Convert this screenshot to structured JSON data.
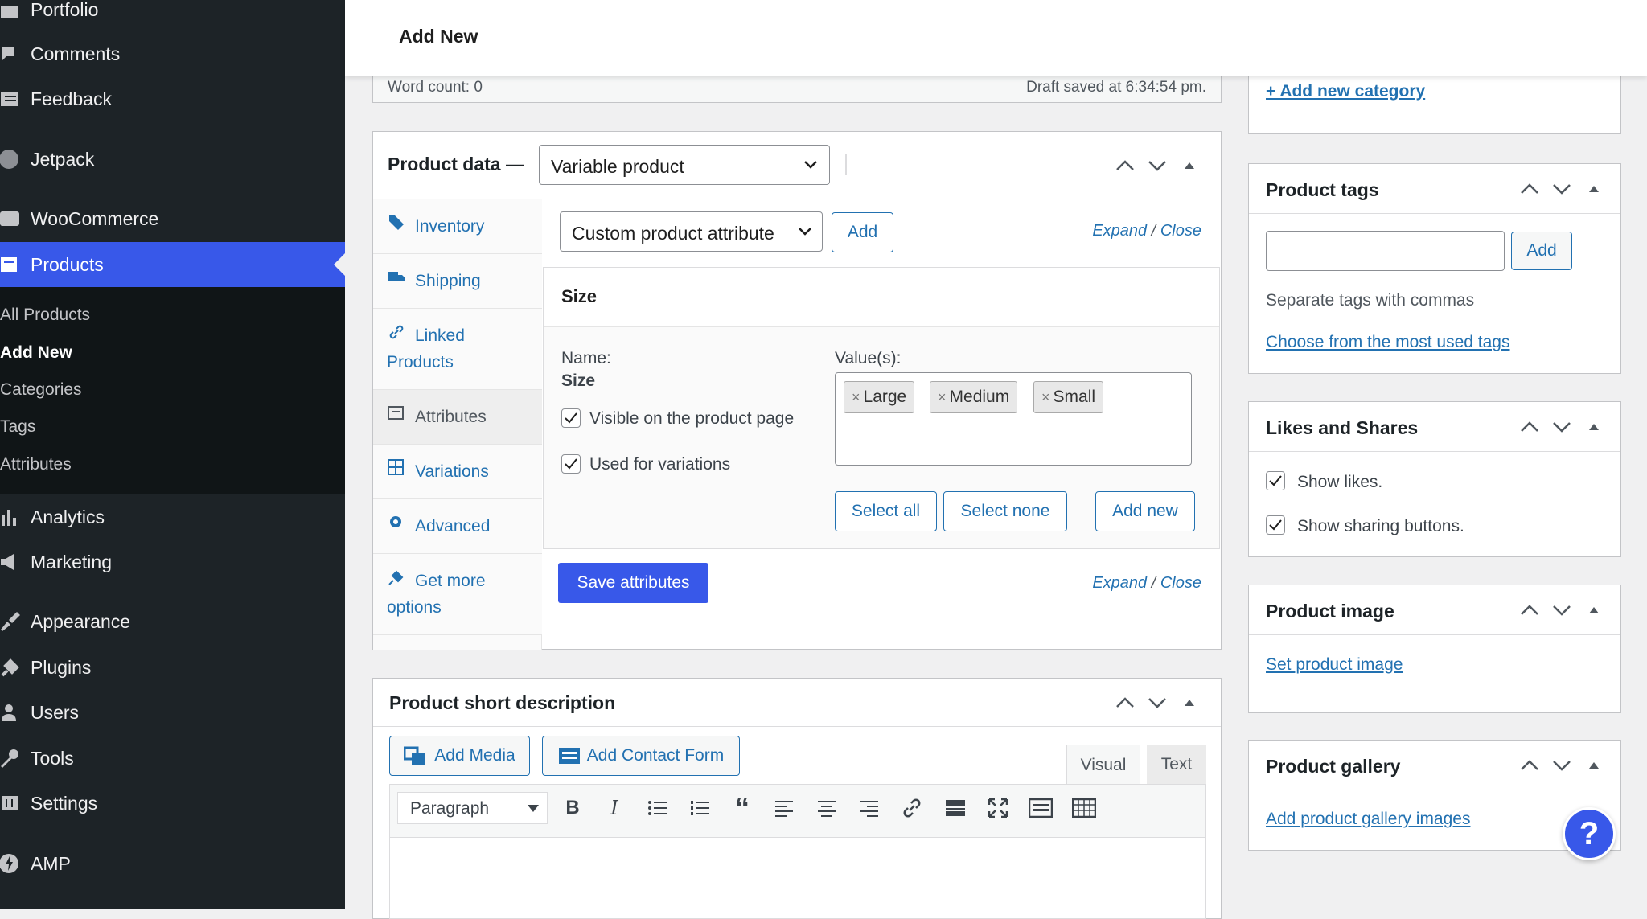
{
  "sidebar": {
    "items": {
      "portfolio": "Portfolio",
      "comments": "Comments",
      "feedback": "Feedback",
      "jetpack": "Jetpack",
      "woocommerce": "WooCommerce",
      "products": "Products",
      "analytics": "Analytics",
      "marketing": "Marketing",
      "appearance": "Appearance",
      "plugins": "Plugins",
      "users": "Users",
      "tools": "Tools",
      "settings": "Settings",
      "amp": "AMP"
    },
    "submenu": {
      "all": "All Products",
      "add": "Add New",
      "categories": "Categories",
      "tags": "Tags",
      "attributes": "Attributes"
    }
  },
  "header": {
    "title": "Add New"
  },
  "editor_status": {
    "word_count": "Word count: 0",
    "draft_saved": "Draft saved at 6:34:54 pm."
  },
  "product_data": {
    "title": "Product data —",
    "type_select": "Variable product",
    "tabs": {
      "inventory": "Inventory",
      "shipping": "Shipping",
      "linked": "Linked",
      "linked2": "Products",
      "attributes": "Attributes",
      "variations": "Variations",
      "advanced": "Advanced",
      "more": "Get more",
      "more2": "options"
    },
    "attr_select": "Custom product attribute",
    "add_button": "Add",
    "expand": "Expand",
    "sep": "/",
    "close": "Close",
    "attribute": {
      "name": "Size",
      "name_label": "Name:",
      "name_value": "Size",
      "values_label": "Value(s):",
      "values": {
        "large": "Large",
        "medium": "Medium",
        "small": "Small"
      },
      "visible_label": "Visible on the product page",
      "variations_label": "Used for variations",
      "select_all": "Select all",
      "select_none": "Select none",
      "add_new": "Add new"
    },
    "save_button": "Save attributes"
  },
  "short_description": {
    "title": "Product short description",
    "add_media": "Add Media",
    "add_contact_form": "Add Contact Form",
    "visual_tab": "Visual",
    "text_tab": "Text",
    "format_select": "Paragraph"
  },
  "right": {
    "add_category": "+ Add new category",
    "tags": {
      "title": "Product tags",
      "add_button": "Add",
      "help": "Separate tags with commas",
      "choose": "Choose from the most used tags",
      "input_value": ""
    },
    "likes": {
      "title": "Likes and Shares",
      "show_likes": "Show likes.",
      "show_sharing": "Show sharing buttons."
    },
    "image": {
      "title": "Product image",
      "set": "Set product image"
    },
    "gallery": {
      "title": "Product gallery",
      "add": "Add product gallery images"
    }
  },
  "help_button": "?",
  "colors": {
    "accent": "#3858e9",
    "sidebar": "#1d2327",
    "link": "#2271b1"
  }
}
